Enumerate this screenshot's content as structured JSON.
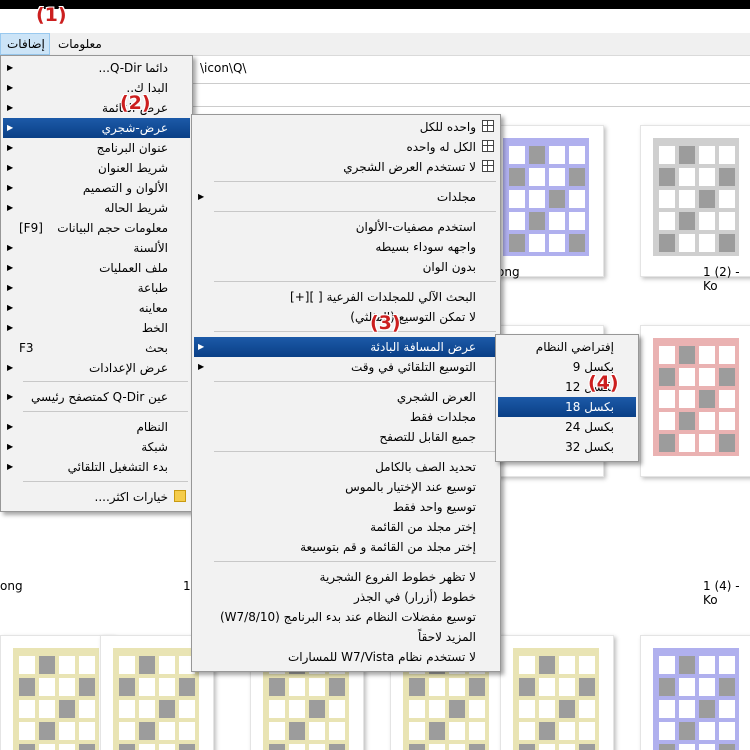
{
  "menubar": {
    "additions": "إضافات",
    "info": "معلومات"
  },
  "address": {
    "path": "\\icon\\Q\\"
  },
  "badges": [
    "(1)",
    "(2)",
    "(3)",
    "(4)"
  ],
  "colors": {
    "blue": "#b0b0ee",
    "gray": "#cfcfcf",
    "red": "#eab2b2",
    "green": "#b8e6b0",
    "yellow": "#e9e4b4",
    "dark": "#9c9c9c"
  },
  "captions": [
    "ong",
    "1 (2) - Ko",
    "ong",
    "1",
    "1 (4) - Ko"
  ],
  "menu1": [
    {
      "label": "دائما Q-Dir...",
      "arrow": true
    },
    {
      "label": "البدا ك..",
      "arrow": true
    },
    {
      "label": "عرض-القائمة",
      "arrow": true
    },
    {
      "label": "عرض-شجري",
      "arrow": true,
      "selected": true
    },
    {
      "label": "عنوان البرنامج",
      "arrow": true
    },
    {
      "label": "شريط العنوان",
      "arrow": true
    },
    {
      "label": "الألوان و التصميم",
      "arrow": true
    },
    {
      "label": "شريط الحاله",
      "arrow": true
    },
    {
      "label": "معلومات حجم البيانات",
      "shortcut": "[F9]"
    },
    {
      "label": "الألسنة",
      "arrow": true
    },
    {
      "label": "ملف العمليات",
      "arrow": true
    },
    {
      "label": "طباعة",
      "arrow": true
    },
    {
      "label": "معاينه",
      "arrow": true
    },
    {
      "label": "الخط",
      "arrow": true
    },
    {
      "label": "بحث",
      "shortcut": "F3"
    },
    {
      "label": "عرض الإعدادات",
      "arrow": true
    },
    {
      "label": "عين Q-Dir كمتصفح رئيسي",
      "arrow": true
    },
    {
      "label": "النظام",
      "arrow": true
    },
    {
      "label": "شبكة",
      "arrow": true
    },
    {
      "label": "بدء التشغيل التلقائي",
      "arrow": true
    },
    {
      "label": "خيارات اكثر....",
      "icon": "folder-icon"
    }
  ],
  "menu2": [
    {
      "label": "واحده للكل",
      "icon": "tree-icon"
    },
    {
      "label": "الكل له واحده",
      "icon": "tree-icon"
    },
    {
      "label": "لا تستخدم العرض الشجري",
      "icon": "tree-icon"
    },
    {
      "label": "مجلدات",
      "arrow": true
    },
    {
      "label": "استخدم مصفيات-الألوان"
    },
    {
      "label": "واجهه سوداء بسيطه"
    },
    {
      "label": "بدون الوان"
    },
    {
      "label": "البحث الآلي للمجلدات الفرعية [ ][+]"
    },
    {
      "label": "لا تمكن التوسيع (المثلثي)"
    },
    {
      "label": "عرض المسافة البادئة",
      "arrow": true,
      "selected": true
    },
    {
      "label": "التوسيع التلقائي في وقت",
      "arrow": true
    },
    {
      "label": "العرض الشجري"
    },
    {
      "label": "مجلدات فقط"
    },
    {
      "label": "جميع القابل للتصفح"
    },
    {
      "label": "تحديد الصف بالكامل"
    },
    {
      "label": "توسيع عند الإختيار بالموس"
    },
    {
      "label": "توسيع واحد فقط"
    },
    {
      "label": "إختر مجلد من القائمة"
    },
    {
      "label": "إختر مجلد من القائمة و قم بتوسيعة"
    },
    {
      "label": "لا تظهر خطوط الفروع الشجرية"
    },
    {
      "label": "خطوط (أزرار) في الجذر"
    },
    {
      "label": "توسيع مفضلات النظام عند بدء البرنامج (W7/8/10)"
    },
    {
      "label": "المزيد لاحقاً"
    },
    {
      "label": "لا تستخدم نظام W7/Vista للمسارات"
    }
  ],
  "menu3": [
    {
      "label": "إفتراضي النظام"
    },
    {
      "label": "بكسل 9"
    },
    {
      "label": "بكسل 12"
    },
    {
      "label": "بكسل 18",
      "selected": true
    },
    {
      "label": "بكسل 24"
    },
    {
      "label": "بكسل 32"
    }
  ]
}
